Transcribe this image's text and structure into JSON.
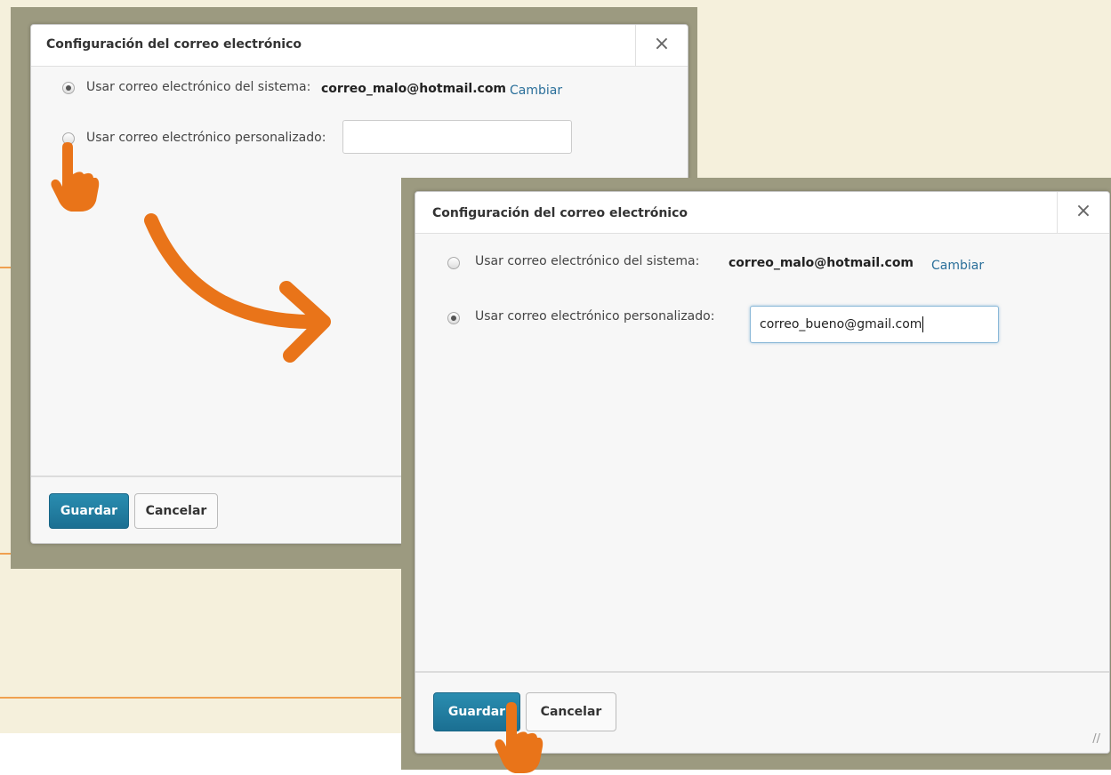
{
  "colors": {
    "accent_orange": "#e97419",
    "primary_button": "#1f7fa3",
    "link": "#2a6f9a",
    "frame_bg": "#9c9a80",
    "page_bg": "#f5f0dc"
  },
  "dialog_before": {
    "title": "Configuración del correo electrónico",
    "close_label": "×",
    "system_option": {
      "label": "Usar correo electrónico del sistema:",
      "email": "correo_malo@hotmail.com",
      "change_link": "Cambiar",
      "checked": true
    },
    "custom_option": {
      "label": "Usar correo electrónico personalizado:",
      "value": "",
      "checked": false
    },
    "save_label": "Guardar",
    "cancel_label": "Cancelar"
  },
  "dialog_after": {
    "title": "Configuración del correo electrónico",
    "close_label": "×",
    "system_option": {
      "label": "Usar correo electrónico del sistema:",
      "email": "correo_malo@hotmail.com",
      "change_link": "Cambiar",
      "checked": false
    },
    "custom_option": {
      "label": "Usar correo electrónico personalizado:",
      "value": "correo_bueno@gmail.com",
      "checked": true
    },
    "save_label": "Guardar",
    "cancel_label": "Cancelar"
  },
  "icons": [
    "pointing-hand-icon",
    "curved-arrow-icon",
    "close-icon",
    "resize-grip-icon"
  ]
}
